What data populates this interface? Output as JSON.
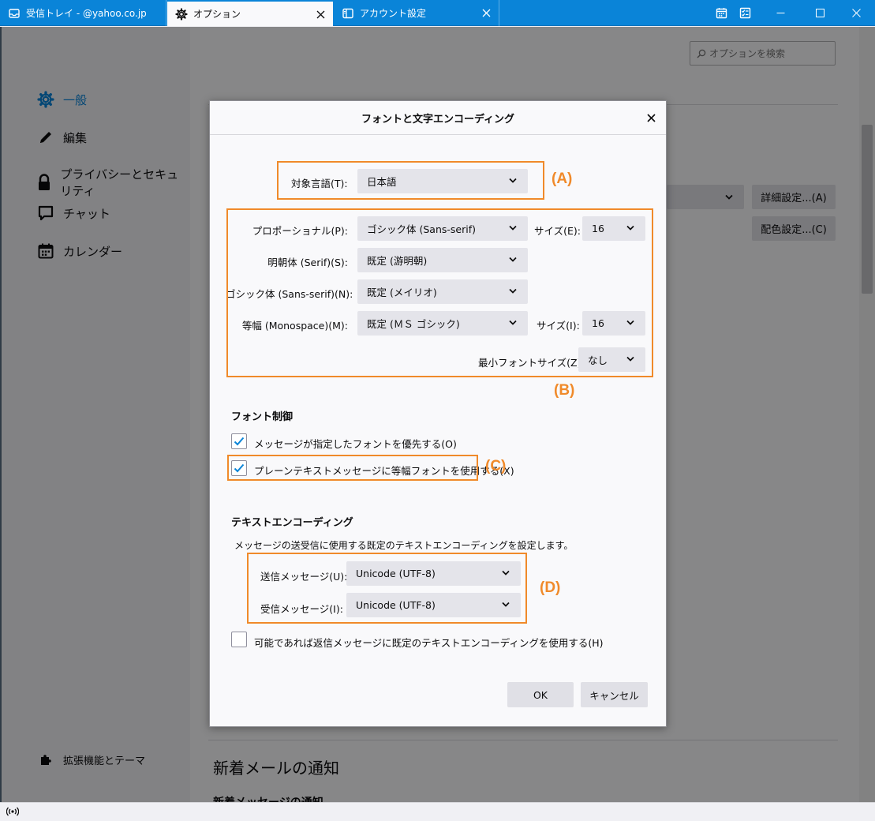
{
  "tabs": [
    {
      "label": "受信トレイ - @yahoo.co.jp",
      "icon": "inbox-icon"
    },
    {
      "label": "オプション",
      "icon": "gear-icon"
    },
    {
      "label": "アカウント設定",
      "icon": "account-settings-icon"
    }
  ],
  "sidebar": {
    "items": [
      {
        "label": "一般",
        "icon": "gear-icon"
      },
      {
        "label": "編集",
        "icon": "pencil-icon"
      },
      {
        "label": "プライバシーとセキュリティ",
        "icon": "lock-icon"
      },
      {
        "label": "チャット",
        "icon": "chat-icon"
      },
      {
        "label": "カレンダー",
        "icon": "calendar-icon"
      }
    ],
    "addons": {
      "label": "拡張機能とテーマ",
      "icon": "puzzle-icon"
    }
  },
  "search": {
    "placeholder": "オプションを検索"
  },
  "background": {
    "advanced_button": "詳細設定...(A)",
    "colors_button": "配色設定...(C)",
    "new_mail_heading": "新着メールの通知",
    "new_mail_sub": "新着メッセージの通知"
  },
  "dialog": {
    "title": "フォントと文字エンコーディング",
    "target_language_label": "対象言語(T):",
    "target_language_value": "日本語",
    "proportional_label": "プロポーショナル(P):",
    "proportional_value": "ゴシック体 (Sans-serif)",
    "size_label_1": "サイズ(E):",
    "size_value_1": "16",
    "serif_label": "明朝体 (Serif)(S):",
    "serif_value": "既定 (游明朝)",
    "sans_label": "ゴシック体 (Sans-serif)(N):",
    "sans_value": "既定 (メイリオ)",
    "mono_label": "等幅 (Monospace)(M):",
    "mono_value": "既定 (ＭＳ ゴシック)",
    "size_label_2": "サイズ(I):",
    "size_value_2": "16",
    "min_font_label": "最小フォントサイズ(Z):",
    "min_font_value": "なし",
    "font_control_title": "フォント制御",
    "cb_prefer_fonts": "メッセージが指定したフォントを優先する(O)",
    "cb_monospace_plain": "プレーンテキストメッセージに等幅フォントを使用する(X)",
    "text_encoding_title": "テキストエンコーディング",
    "text_encoding_desc": "メッセージの送受信に使用する既定のテキストエンコーディングを設定します。",
    "outgoing_label": "送信メッセージ(U):",
    "outgoing_value": "Unicode (UTF-8)",
    "incoming_label": "受信メッセージ(I):",
    "incoming_value": "Unicode (UTF-8)",
    "cb_reply_encoding": "可能であれば返信メッセージに既定のテキストエンコーディングを使用する(H)",
    "ok": "OK",
    "cancel": "キャンセル"
  },
  "checkbox_states": {
    "prefer_fonts": true,
    "monospace_plain": true,
    "reply_encoding": false
  },
  "annotations": [
    "(A)",
    "(B)",
    "(C)",
    "(D)"
  ],
  "colors": {
    "accent": "#0a84d8",
    "annotation": "#f08a2a"
  }
}
